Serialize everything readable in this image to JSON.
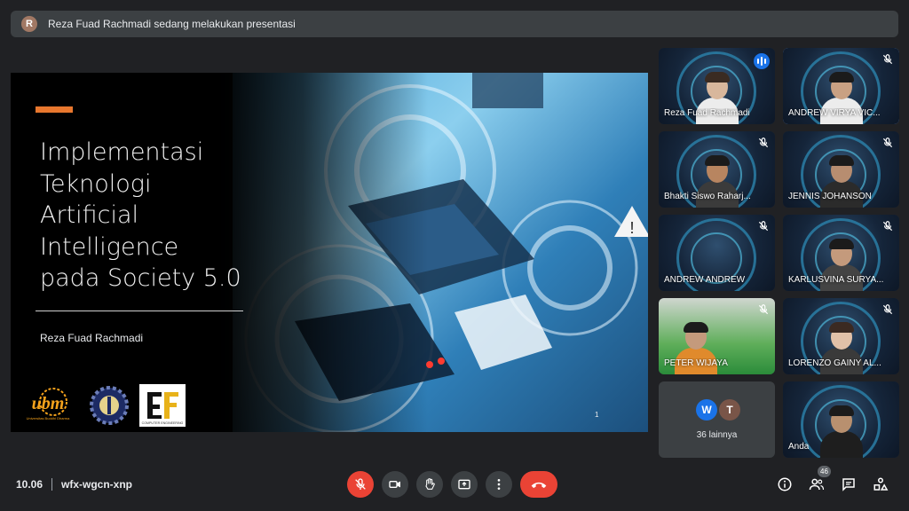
{
  "banner": {
    "avatar_letter": "R",
    "text": "Reza Fuad Rachmadi sedang melakukan presentasi"
  },
  "slide": {
    "title_lines": [
      "Implementasi",
      "Teknologi",
      "Artificial",
      "Intelligence",
      "pada Society 5.0"
    ],
    "author": "Reza Fuad Rachmadi",
    "page_number": "1",
    "logos": {
      "ubm": "ubm",
      "ubm_sub": "Universitas Buddhi Dharma",
      "ce": "COMPUTER ENGINEERING"
    }
  },
  "participants": [
    {
      "name": "Reza Fuad Rachmadi",
      "speaking": true
    },
    {
      "name": "ANDREW VIRYA VIC...",
      "active": true
    },
    {
      "name": "Bhakti Siswo Raharj..."
    },
    {
      "name": "JENNIS JOHANSON"
    },
    {
      "name": "ANDREW ANDREW"
    },
    {
      "name": "KARLUSVINA SURYA..."
    },
    {
      "name": "PETER WIJAYA"
    },
    {
      "name": "LORENZO GAINY AL..."
    },
    {
      "name": "Anda"
    }
  ],
  "overflow": {
    "avatars": [
      "W",
      "T"
    ],
    "label": "36 lainnya"
  },
  "bottom_bar": {
    "time": "10.06",
    "meeting_code": "wfx-wgcn-xnp",
    "people_count": "46"
  },
  "colors": {
    "background": "#202124",
    "banner": "#3c4043",
    "danger": "#ea4335",
    "accent_orange": "#e8772e",
    "speaking_blue": "#1a73e8"
  },
  "icons": [
    "mic-off-icon",
    "camera-icon",
    "raise-hand-icon",
    "present-icon",
    "more-options-icon",
    "end-call-icon",
    "info-icon",
    "people-icon",
    "chat-icon",
    "activities-icon"
  ]
}
